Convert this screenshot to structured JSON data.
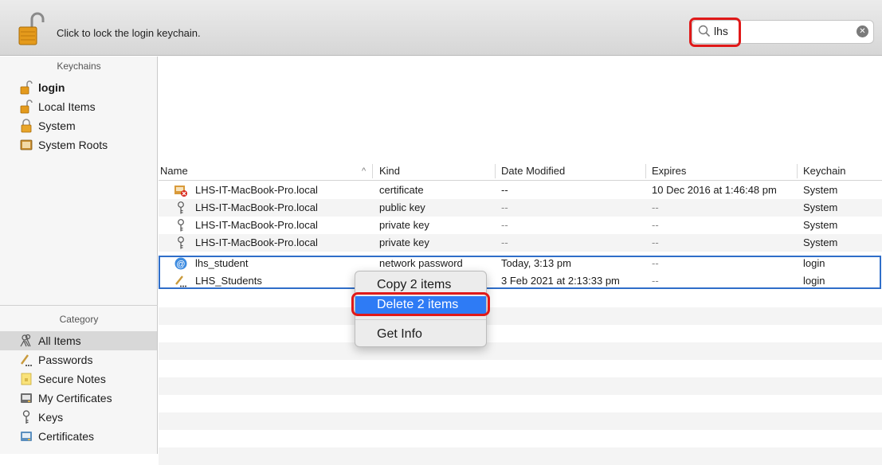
{
  "toolbar": {
    "lock_message": "Click to lock the login keychain.",
    "search_value": "lhs",
    "clear_icon": "clear-icon"
  },
  "sidebar": {
    "keychains_header": "Keychains",
    "keychains": [
      {
        "label": "login",
        "icon": "unlocked-padlock-icon",
        "bold": true
      },
      {
        "label": "Local Items",
        "icon": "unlocked-padlock-icon"
      },
      {
        "label": "System",
        "icon": "locked-padlock-icon"
      },
      {
        "label": "System Roots",
        "icon": "cabinet-icon"
      }
    ],
    "category_header": "Category",
    "categories": [
      {
        "label": "All Items",
        "icon": "people-icon",
        "selected": true
      },
      {
        "label": "Passwords",
        "icon": "pencil-dots-icon"
      },
      {
        "label": "Secure Notes",
        "icon": "note-icon"
      },
      {
        "label": "My Certificates",
        "icon": "certificate-icon"
      },
      {
        "label": "Keys",
        "icon": "key-icon"
      },
      {
        "label": "Certificates",
        "icon": "certificate-icon"
      }
    ]
  },
  "table": {
    "columns": [
      "Name",
      "Kind",
      "Date Modified",
      "Expires",
      "Keychain"
    ],
    "sort_indicator": "^",
    "rows": [
      {
        "name": "LHS-IT-MacBook-Pro.local",
        "kind": "certificate",
        "date": "--",
        "expires": "10 Dec 2016 at 1:46:48 pm",
        "keychain": "System",
        "icon": "certificate-error-icon"
      },
      {
        "name": "LHS-IT-MacBook-Pro.local",
        "kind": "public key",
        "date": "--",
        "expires": "--",
        "keychain": "System",
        "icon": "key-icon"
      },
      {
        "name": "LHS-IT-MacBook-Pro.local",
        "kind": "private key",
        "date": "--",
        "expires": "--",
        "keychain": "System",
        "icon": "key-icon"
      },
      {
        "name": "LHS-IT-MacBook-Pro.local",
        "kind": "private key",
        "date": "--",
        "expires": "--",
        "keychain": "System",
        "icon": "key-icon"
      },
      {
        "name": "lhs_student",
        "kind": "network password",
        "date": "Today, 3:13 pm",
        "expires": "--",
        "keychain": "login",
        "icon": "at-sign-icon"
      },
      {
        "name": "LHS_Students",
        "kind": "",
        "date": "3 Feb 2021 at 2:13:33 pm",
        "expires": "--",
        "keychain": "login",
        "icon": "pencil-dots-icon"
      }
    ]
  },
  "context_menu": {
    "items": [
      "Copy 2 items",
      "Delete 2 items",
      "Get Info"
    ],
    "highlighted_index": 1,
    "highlight_color": "#2e7bf5"
  },
  "annotation_color": "#e01919"
}
